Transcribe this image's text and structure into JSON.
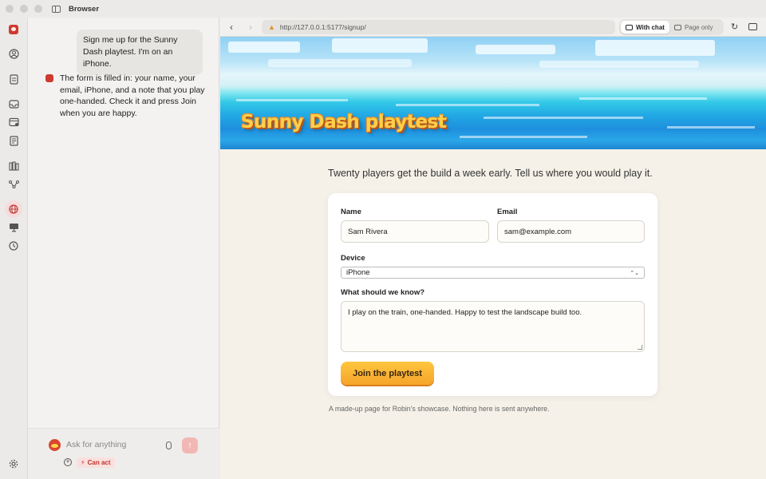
{
  "window": {
    "title": "Browser"
  },
  "rail": {
    "icons": [
      "robin-logo-icon",
      "profile-icon",
      "document-icon",
      "inbox-icon",
      "calendar-icon",
      "notes-icon",
      "library-icon",
      "graph-icon",
      "globe-icon",
      "display-icon",
      "history-icon",
      "settings-icon"
    ]
  },
  "chat": {
    "user_message": "Sign me up for the Sunny Dash playtest. I'm on an iPhone.",
    "assistant_message": "The form is filled in: your name, your email, iPhone, and a note that you play one-handed. Check it and press Join when you are happy.",
    "input_placeholder": "Ask for anything",
    "can_act_label": "Can act"
  },
  "toolbar": {
    "url": "http://127.0.0.1:5177/signup/",
    "mode_with_chat": "With chat",
    "mode_page_only": "Page only"
  },
  "page": {
    "hero_title": "Sunny Dash playtest",
    "intro": "Twenty players get the build a week early. Tell us where you would play it.",
    "form": {
      "name_label": "Name",
      "name_value": "Sam Rivera",
      "email_label": "Email",
      "email_value": "sam@example.com",
      "device_label": "Device",
      "device_value": "iPhone",
      "notes_label": "What should we know?",
      "notes_value": "I play on the train, one-handed. Happy to test the landscape build too.",
      "submit_label": "Join the playtest"
    },
    "footnote": "A made-up page for Robin's showcase. Nothing here is sent anywhere."
  },
  "colors": {
    "accent_button": "#f5a42a",
    "hero_title": "#ffcf4a",
    "page_background": "#f5f1e8",
    "can_act": "#c8322a"
  }
}
